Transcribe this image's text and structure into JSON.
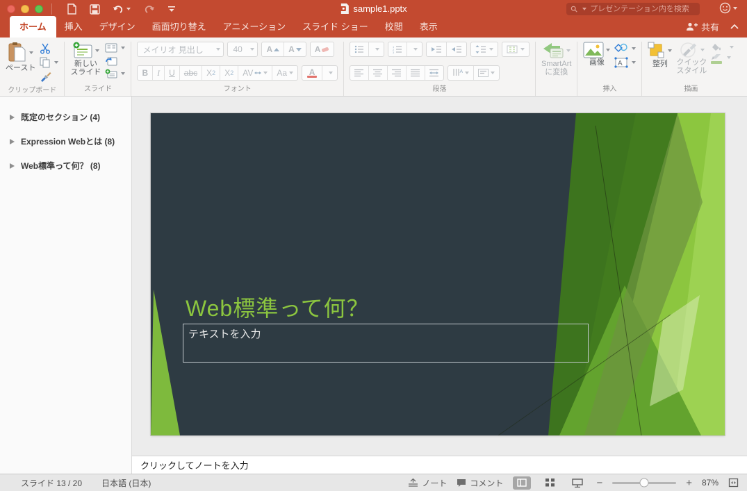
{
  "window": {
    "title": "sample1.pptx"
  },
  "titlebar": {
    "search_placeholder": "プレゼンテーション内を検索"
  },
  "tabs": {
    "items": [
      {
        "label": "ホーム"
      },
      {
        "label": "挿入"
      },
      {
        "label": "デザイン"
      },
      {
        "label": "画面切り替え"
      },
      {
        "label": "アニメーション"
      },
      {
        "label": "スライド ショー"
      },
      {
        "label": "校閲"
      },
      {
        "label": "表示"
      }
    ],
    "share_label": "共有"
  },
  "ribbon": {
    "clipboard": {
      "label": "クリップボード",
      "paste": "ペースト"
    },
    "slides": {
      "label": "スライド",
      "new_slide_1": "新しい",
      "new_slide_2": "スライド"
    },
    "font": {
      "label": "フォント",
      "name": "メイリオ 見出し",
      "size": "40",
      "grow": "A",
      "shrink": "A",
      "clear": "A",
      "bold": "B",
      "italic": "I",
      "underline": "U",
      "strike": "abc",
      "sup_base": "X",
      "sup_n": "2",
      "sub_base": "X",
      "sub_n": "2",
      "spacing": "AV",
      "case": "Aa",
      "color": "A"
    },
    "paragraph": {
      "label": "段落",
      "smartart_1": "SmartArt",
      "smartart_2": "に変換"
    },
    "insert": {
      "label": "挿入",
      "picture": "画像"
    },
    "draw": {
      "label": "描画",
      "arrange": "整列",
      "quick_1": "クイック",
      "quick_2": "スタイル"
    }
  },
  "sidebar": {
    "sections": [
      {
        "label": "既定のセクション (4)"
      },
      {
        "label": "Expression Webとは (8)"
      },
      {
        "label": "Web標準って何？ (8)"
      }
    ]
  },
  "slide": {
    "title": "Web標準って何？",
    "body_placeholder": "テキストを入力"
  },
  "notes": {
    "placeholder": "クリックしてノートを入力"
  },
  "statusbar": {
    "slide_counter": "スライド 13 / 20",
    "language": "日本語 (日本)",
    "notes": "ノート",
    "comments": "コメント",
    "zoom": "87%"
  },
  "colors": {
    "chrome": "#C3492F",
    "active_tab_text": "#C13E1E",
    "slide_bg": "#2E3B43",
    "title_green": "#8CC63F",
    "green_bright": "#8CC63F",
    "green_light": "#9DD252",
    "green_dark": "#3E771C",
    "green_mid": "#63A32E",
    "green_olive": "#6E9440",
    "green_pale": "#D6E9B0",
    "green_wedge": "#7EBA3D"
  }
}
